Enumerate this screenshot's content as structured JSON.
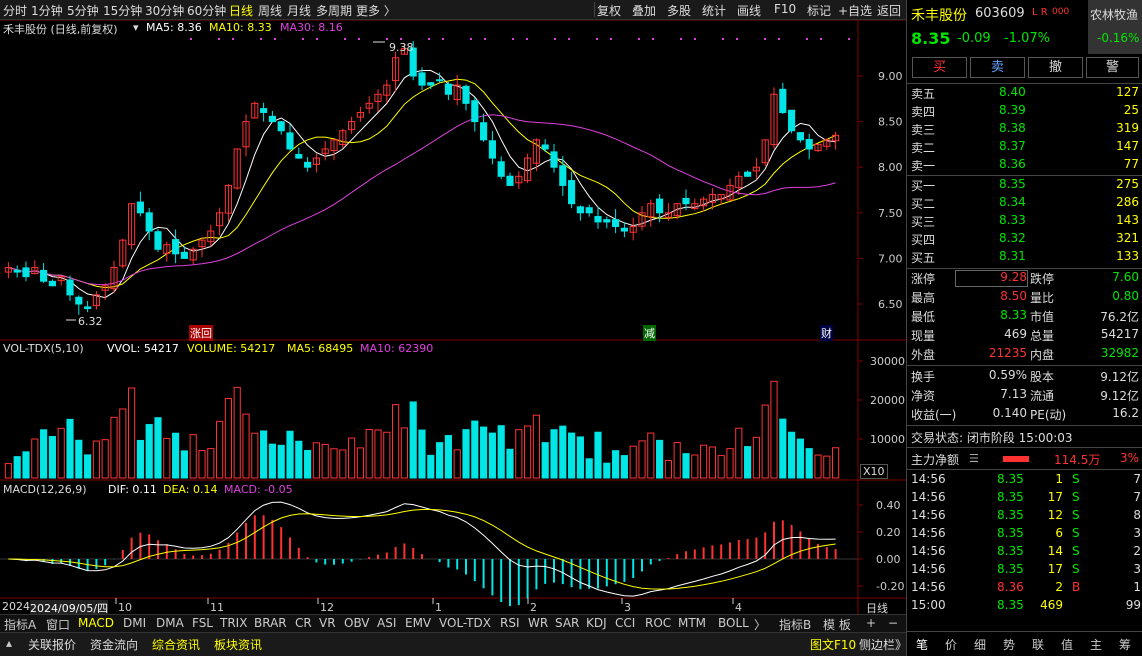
{
  "toolbar": {
    "left_items": [
      "分时",
      "1分钟",
      "5分钟",
      "15分钟",
      "30分钟",
      "60分钟",
      "日线",
      "周线",
      "月线",
      "多周期",
      "更多 〉"
    ],
    "active": "日线",
    "right_items": [
      "复权",
      "叠加",
      "多股",
      "统计",
      "画线",
      "F10",
      "标记",
      "+自选",
      "返回"
    ]
  },
  "chart_header": {
    "name": "禾丰股份 (日线,前复权)",
    "ma5": "MA5: 8.36",
    "ma10": "MA10: 8.33",
    "ma30": "MA30: 8.16",
    "high_mark": "9.38",
    "low_mark": "6.32"
  },
  "price_axis": [
    "9.00",
    "8.50",
    "8.00",
    "7.50",
    "7.00",
    "6.50"
  ],
  "events": [
    "涨回",
    "减",
    "财"
  ],
  "volume_header": {
    "name": "VOL-TDX(5,10)",
    "vvol": "VVOL: 54217",
    "volume": "VOLUME: 54217",
    "ma5": "MA5: 68495",
    "ma10": "MA10: 62390"
  },
  "volume_axis": [
    "30000",
    "20000",
    "10000"
  ],
  "volume_unit": "X10",
  "macd_header": {
    "name": "MACD(12,26,9)",
    "dif": "DIF: 0.11",
    "dea": "DEA: 0.14",
    "macd": "MACD: -0.05"
  },
  "macd_axis": [
    "0.40",
    "0.20",
    "0.00",
    "-0.20"
  ],
  "date_axis": {
    "start": "2024",
    "cursor": "2024/09/05/四",
    "months": [
      "10",
      "11",
      "12",
      "1",
      "2",
      "3",
      "4"
    ],
    "period": "日线"
  },
  "indicator_tabs": [
    "指标A",
    "窗口",
    "MACD",
    "DMI",
    "DMA",
    "FSL",
    "TRIX",
    "BRAR",
    "CR",
    "VR",
    "OBV",
    "ASI",
    "EMV",
    "VOL-TDX",
    "RSI",
    "WR",
    "SAR",
    "KDJ",
    "CCI",
    "ROC",
    "MTM",
    "BOLL",
    "〉",
    "指标B",
    "模 板",
    "+",
    "−"
  ],
  "active_indicator": "MACD",
  "bottom_bar": {
    "items": [
      "关联报价",
      "资金流向",
      "综合资讯",
      "板块资讯"
    ],
    "right": "图文F10",
    "right2": "侧边栏》"
  },
  "chart_data": {
    "type": "candlestick",
    "title": "禾丰股份 (日线,前复权)",
    "xlabel": "",
    "ylabel": "",
    "ylim": [
      6.2,
      9.6
    ],
    "x_ticks": [
      "2024/09/05",
      "10",
      "11",
      "12",
      "1",
      "2",
      "3",
      "4"
    ],
    "series": [
      {
        "name": "MA5",
        "last": 8.36
      },
      {
        "name": "MA10",
        "last": 8.33
      },
      {
        "name": "MA30",
        "last": 8.16
      }
    ],
    "annotations": [
      {
        "label": "9.38",
        "type": "high"
      },
      {
        "label": "6.32",
        "type": "low"
      }
    ],
    "close_path": [
      6.9,
      6.85,
      6.8,
      6.9,
      6.75,
      6.7,
      6.8,
      6.6,
      6.5,
      6.45,
      6.6,
      6.7,
      6.9,
      7.2,
      7.6,
      7.5,
      7.3,
      7.1,
      7.15,
      7.05,
      7.0,
      7.1,
      7.2,
      7.3,
      7.5,
      7.8,
      8.2,
      8.5,
      8.7,
      8.6,
      8.5,
      8.4,
      8.2,
      8.1,
      8.0,
      8.1,
      8.2,
      8.3,
      8.4,
      8.5,
      8.6,
      8.7,
      8.8,
      8.9,
      9.2,
      9.3,
      9.0,
      8.9,
      8.9,
      8.95,
      8.8,
      8.9,
      8.7,
      8.5,
      8.3,
      8.1,
      7.9,
      7.8,
      7.9,
      8.1,
      8.3,
      8.2,
      8.0,
      7.8,
      7.6,
      7.5,
      7.5,
      7.4,
      7.4,
      7.35,
      7.3,
      7.35,
      7.5,
      7.6,
      7.5,
      7.5,
      7.6,
      7.6,
      7.6,
      7.65,
      7.7,
      7.7,
      7.8,
      7.9,
      7.9,
      8.0,
      8.3,
      8.8,
      8.6,
      8.4,
      8.3,
      8.2,
      8.25,
      8.3,
      8.35
    ],
    "volume_ma": {
      "ma5": 68495,
      "ma10": 62390,
      "last": 54217
    },
    "macd": {
      "dif": 0.11,
      "dea": 0.14,
      "macd": -0.05
    }
  },
  "quote": {
    "name": "禾丰股份",
    "code": "603609",
    "flags": "L R",
    "flags2": "000",
    "sector": "农林牧渔",
    "sector_change": "-0.16%",
    "price": "8.35",
    "change": "-0.09",
    "change_pct": "-1.07%",
    "buttons": [
      "买",
      "卖",
      "撤",
      "警"
    ],
    "asks": [
      {
        "label": "卖五",
        "price": "8.40",
        "vol": "127"
      },
      {
        "label": "卖四",
        "price": "8.39",
        "vol": "25"
      },
      {
        "label": "卖三",
        "price": "8.38",
        "vol": "319"
      },
      {
        "label": "卖二",
        "price": "8.37",
        "vol": "147"
      },
      {
        "label": "卖一",
        "price": "8.36",
        "vol": "77"
      }
    ],
    "bids": [
      {
        "label": "买一",
        "price": "8.35",
        "vol": "275"
      },
      {
        "label": "买二",
        "price": "8.34",
        "vol": "286"
      },
      {
        "label": "买三",
        "price": "8.33",
        "vol": "143"
      },
      {
        "label": "买四",
        "price": "8.32",
        "vol": "321"
      },
      {
        "label": "买五",
        "price": "8.31",
        "vol": "133"
      }
    ],
    "stats": [
      {
        "l1": "涨停",
        "v1": "9.28",
        "l2": "跌停",
        "v2": "7.60"
      },
      {
        "l1": "最高",
        "v1": "8.50",
        "l2": "量比",
        "v2": "0.80"
      },
      {
        "l1": "最低",
        "v1": "8.33",
        "l2": "市值",
        "v2": "76.2亿"
      },
      {
        "l1": "现量",
        "v1": "469",
        "l2": "总量",
        "v2": "54217"
      },
      {
        "l1": "外盘",
        "v1": "21235",
        "l2": "内盘",
        "v2": "32982"
      }
    ],
    "stats2": [
      {
        "l1": "换手",
        "v1": "0.59%",
        "l2": "股本",
        "v2": "9.12亿"
      },
      {
        "l1": "净资",
        "v1": "7.13",
        "l2": "流通",
        "v2": "9.12亿"
      },
      {
        "l1": "收益(一)",
        "v1": "0.140",
        "l2": "PE(动)",
        "v2": "16.2"
      }
    ],
    "trade_status": "交易状态: 闭市阶段 15:00:03",
    "main_flow_label": "主力净额",
    "main_flow_value": "114.5万",
    "main_flow_pct": "3%",
    "ticks": [
      {
        "t": "14:56",
        "p": "8.35",
        "v": "1",
        "d": "S",
        "n": "7"
      },
      {
        "t": "14:56",
        "p": "8.35",
        "v": "17",
        "d": "S",
        "n": "7"
      },
      {
        "t": "14:56",
        "p": "8.35",
        "v": "12",
        "d": "S",
        "n": "8"
      },
      {
        "t": "14:56",
        "p": "8.35",
        "v": "6",
        "d": "S",
        "n": "3"
      },
      {
        "t": "14:56",
        "p": "8.35",
        "v": "14",
        "d": "S",
        "n": "2"
      },
      {
        "t": "14:56",
        "p": "8.35",
        "v": "17",
        "d": "S",
        "n": "3"
      },
      {
        "t": "14:56",
        "p": "8.36",
        "v": "2",
        "d": "B",
        "n": "1"
      },
      {
        "t": "15:00",
        "p": "8.35",
        "v": "469",
        "d": "",
        "n": "99"
      }
    ],
    "bottom_tabs": [
      "笔",
      "价",
      "细",
      "势",
      "联",
      "值",
      "主",
      "筹"
    ]
  }
}
